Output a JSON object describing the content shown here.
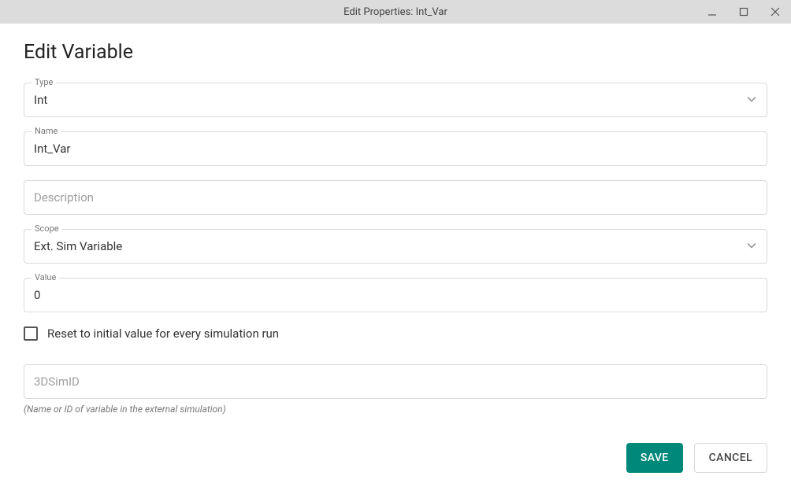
{
  "window": {
    "title": "Edit Properties: Int_Var"
  },
  "heading": "Edit Variable",
  "fields": {
    "type": {
      "label": "Type",
      "value": "Int"
    },
    "name": {
      "label": "Name",
      "value": "Int_Var"
    },
    "description": {
      "placeholder": "Description",
      "value": ""
    },
    "scope": {
      "label": "Scope",
      "value": "Ext. Sim Variable"
    },
    "value": {
      "label": "Value",
      "value": "0"
    },
    "reset_checkbox": {
      "label": "Reset to initial value for every simulation run",
      "checked": false
    },
    "simid": {
      "placeholder": "3DSimID",
      "value": "",
      "helper": "(Name or ID of variable in the external simulation)"
    }
  },
  "actions": {
    "save": "SAVE",
    "cancel": "CANCEL"
  }
}
